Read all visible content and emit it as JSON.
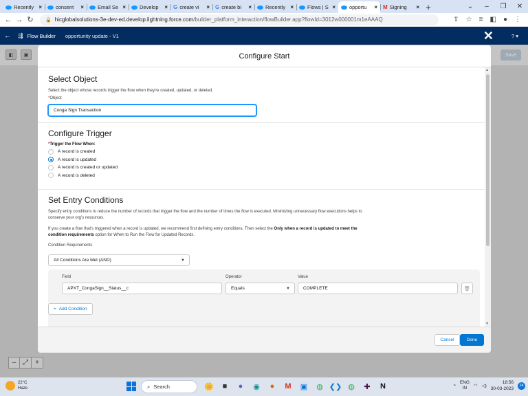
{
  "browser": {
    "tabs": [
      {
        "label": "Recently",
        "icon": "salesforce-cloud-icon"
      },
      {
        "label": "consent",
        "icon": "salesforce-cloud-icon"
      },
      {
        "label": "Email Se",
        "icon": "salesforce-cloud-icon"
      },
      {
        "label": "Develop",
        "icon": "salesforce-cloud-icon"
      },
      {
        "label": "create vi",
        "icon": "google-g-icon"
      },
      {
        "label": "create bi",
        "icon": "google-g-icon"
      },
      {
        "label": "Recently",
        "icon": "salesforce-cloud-icon"
      },
      {
        "label": "Flows | S",
        "icon": "salesforce-cloud-icon"
      },
      {
        "label": "opportu",
        "icon": "salesforce-cloud-icon"
      },
      {
        "label": "Signing",
        "icon": "gmail-icon"
      }
    ],
    "url_host": "hicglobalsolutions-3e-dev-ed.develop.lightning.force.com",
    "url_path": "/builder_platform_interaction/flowBuilder.app?flowId=3012w000001m1eAAAQ"
  },
  "flow_builder": {
    "app_name": "Flow Builder",
    "flow_name": "opportunity update - V1",
    "help": "? ▾",
    "save": "Save"
  },
  "modal": {
    "title": "Configure Start",
    "select_object": {
      "heading": "Select Object",
      "description": "Select the object whose records trigger the flow when they're created, updated, or deleted.",
      "field_label": "Object",
      "value": "Conga Sign Transaction"
    },
    "configure_trigger": {
      "heading": "Configure Trigger",
      "label": "Trigger the Flow When:",
      "options": [
        {
          "label": "A record is created",
          "selected": false
        },
        {
          "label": "A record is updated",
          "selected": true
        },
        {
          "label": "A record is created or updated",
          "selected": false
        },
        {
          "label": "A record is deleted",
          "selected": false
        }
      ]
    },
    "entry_conditions": {
      "heading": "Set Entry Conditions",
      "description_1": "Specify entry conditions to reduce the number of records that trigger the flow and the number of times the flow is executed. Minimizing unnecessary flow executions helps to conserve your org's resources.",
      "description_2_a": "If you create a flow that's triggered when a record is updated, we recommend first defining entry conditions. Then select the ",
      "description_2_b": "Only when a record is updated to meet the condition requirements",
      "description_2_c": " option for When to Run the Flow for Updated Records.",
      "requirements_label": "Condition Requirements",
      "requirements_value": "All Conditions Are Met (AND)",
      "field_header": "Field",
      "operator_header": "Operator",
      "value_header": "Value",
      "condition_field": "APXT_CongaSign__Status__c",
      "condition_operator": "Equals",
      "condition_value": "COMPLETE",
      "add_condition": "Add Condition"
    },
    "cancel": "Cancel",
    "done": "Done"
  },
  "taskbar": {
    "temperature": "22°C",
    "weather": "Haze",
    "search": "Search",
    "lang_1": "ENG",
    "lang_2": "IN",
    "time": "18:56",
    "date": "30-03-2023",
    "notifications": "24"
  }
}
